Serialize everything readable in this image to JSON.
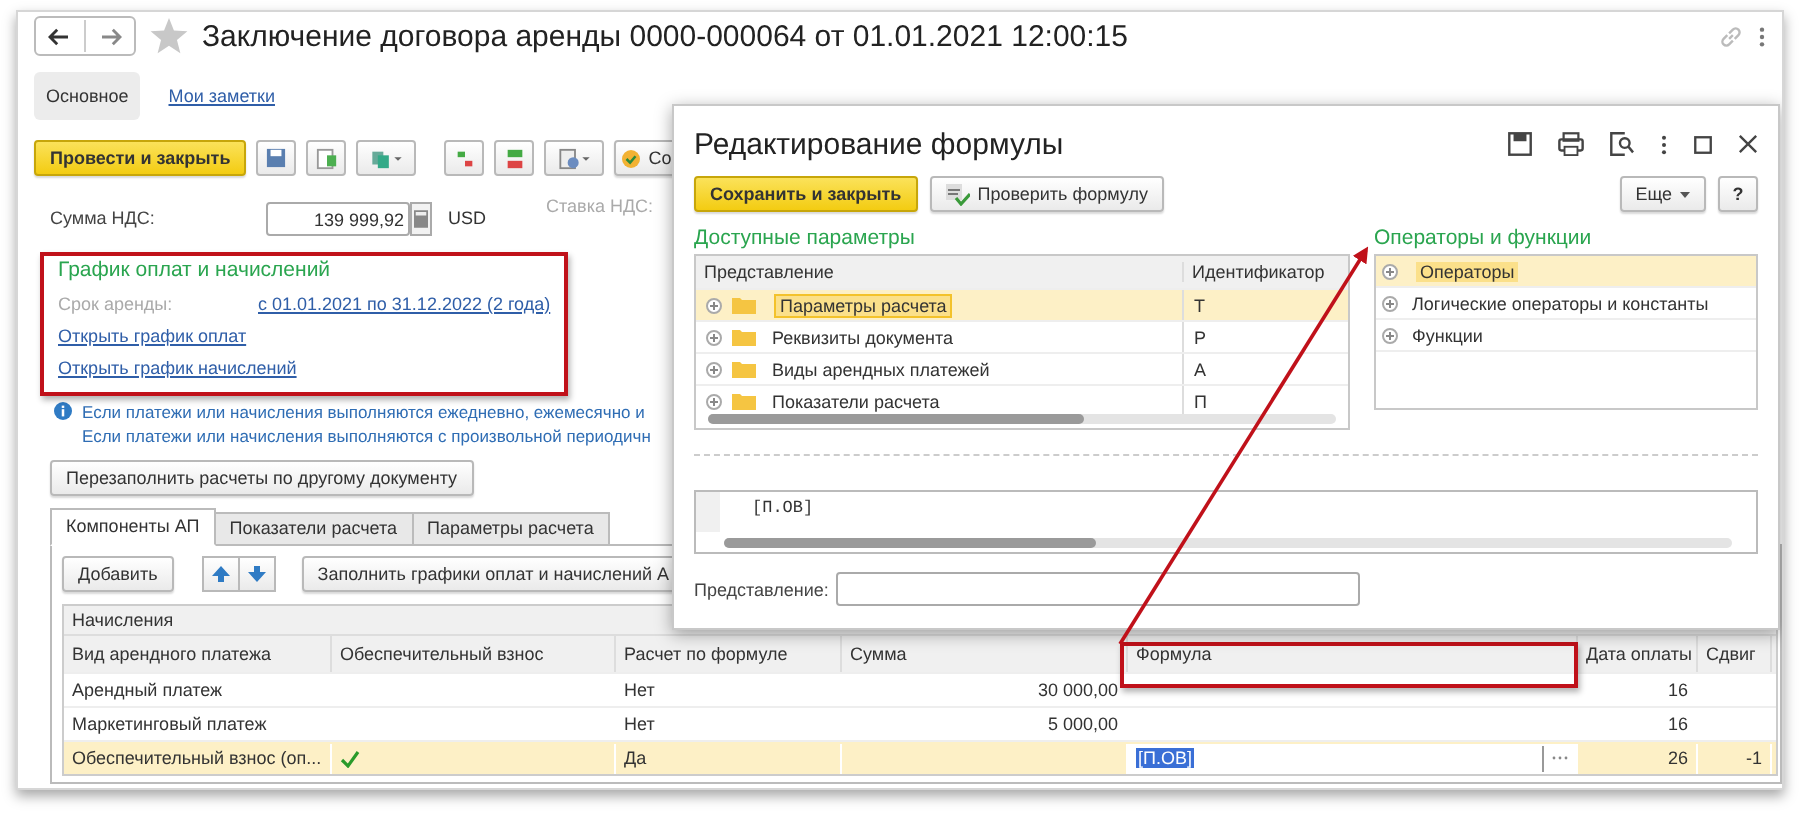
{
  "window": {
    "title": "Заключение договора аренды 0000-000064 от 01.01.2021 12:00:15"
  },
  "form_tabs": [
    {
      "label": "Основное",
      "selected": true
    },
    {
      "label": "Мои заметки",
      "selected": false
    }
  ],
  "toolbar": {
    "post_button": "Провести и закрыть",
    "cut_button": "Со"
  },
  "vat": {
    "label": "Сумма НДС:",
    "value": "139 999,92",
    "currency": "USD",
    "rate_label": "Ставка НДС:"
  },
  "schedule": {
    "title": "График оплат и начислений",
    "term_label": "Срок аренды:",
    "term_link": "с 01.01.2021 по 31.12.2022 (2 года)",
    "links": [
      "Открыть график оплат",
      "Открыть график начислений"
    ]
  },
  "info_lines": [
    "Если платежи или начисления выполняются ежедневно, ежемесячно и",
    "Если платежи или начисления выполняются с произвольной периодичн"
  ],
  "refill_button": "Перезаполнить расчеты по другому документу",
  "tabs": [
    {
      "label": "Компоненты АП",
      "selected": true
    },
    {
      "label": "Показатели расчета",
      "selected": false
    },
    {
      "label": "Параметры расчета",
      "selected": false
    }
  ],
  "table_toolbar": {
    "add_button": "Добавить",
    "fill_button": "Заполнить графики оплат и начислений А"
  },
  "table": {
    "group": "Начисления",
    "columns": [
      "Вид арендного платежа",
      "Обеспечительный взнос",
      "Расчет по формуле",
      "Сумма",
      "Формула",
      "Дата оплаты",
      "Сдвиг"
    ],
    "rows": [
      {
        "name": "Арендный платеж",
        "deposit": false,
        "calc": "Нет",
        "sum": "30 000,00",
        "date": "16",
        "selected": false
      },
      {
        "name": "Маркетинговый платеж",
        "deposit": false,
        "calc": "Нет",
        "sum": "5 000,00",
        "date": "16",
        "selected": false
      },
      {
        "name": "Обеспечительный взнос (оп...",
        "deposit": true,
        "calc": "Да",
        "formula": "[П.ОВ]",
        "date": "26",
        "shift": "-1",
        "selected": true
      }
    ]
  },
  "dialog": {
    "title": "Редактирование формулы",
    "save_button": "Сохранить и закрыть",
    "check_button": "Проверить формулу",
    "more_button": "Еще",
    "help_button": "?",
    "params_title": "Доступные параметры",
    "params_columns": [
      "Представление",
      "Идентификатор"
    ],
    "params": [
      {
        "name": "Параметры расчета",
        "id": "Т",
        "selected": true
      },
      {
        "name": "Реквизиты документа",
        "id": "Р",
        "selected": false
      },
      {
        "name": "Виды арендных платежей",
        "id": "А",
        "selected": false
      },
      {
        "name": "Показатели расчета",
        "id": "П",
        "selected": false
      }
    ],
    "ops_title": "Операторы и функции",
    "operators": [
      {
        "name": "Операторы",
        "selected": true
      },
      {
        "name": "Логические операторы и константы",
        "selected": false
      },
      {
        "name": "Функции",
        "selected": false
      }
    ],
    "formula": "[П.ОВ]",
    "repr_label": "Представление:"
  }
}
